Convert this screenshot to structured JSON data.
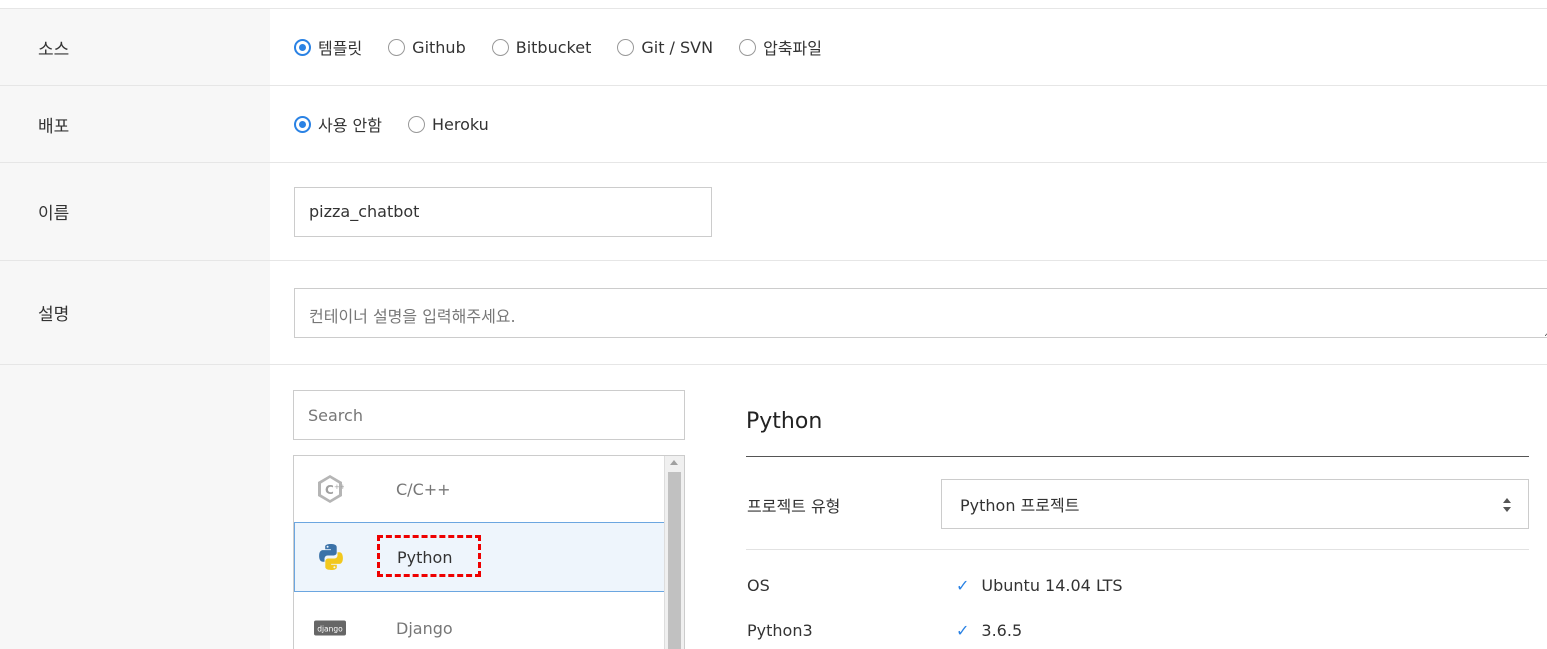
{
  "source": {
    "label": "소스",
    "options": [
      "템플릿",
      "Github",
      "Bitbucket",
      "Git / SVN",
      "압축파일"
    ],
    "selected": "템플릿"
  },
  "deploy": {
    "label": "배포",
    "options": [
      "사용 안함",
      "Heroku"
    ],
    "selected": "사용 안함"
  },
  "name": {
    "label": "이름",
    "value": "pizza_chatbot"
  },
  "description": {
    "label": "설명",
    "placeholder": "컨테이너 설명을 입력해주세요."
  },
  "stack": {
    "search_placeholder": "Search",
    "items": [
      {
        "label": "C/C++",
        "icon": "cpp-icon"
      },
      {
        "label": "Python",
        "icon": "python-icon",
        "selected": true
      },
      {
        "label": "Django",
        "icon": "django-icon",
        "icon_text": "django"
      }
    ]
  },
  "detail": {
    "title": "Python",
    "project_type_label": "프로젝트 유형",
    "project_type_value": "Python 프로젝트",
    "specs": [
      {
        "key": "OS",
        "value": "Ubuntu 14.04 LTS"
      },
      {
        "key": "Python3",
        "value": "3.6.5"
      }
    ]
  },
  "colors": {
    "accent": "#2a82e4",
    "highlight": "#e00000"
  }
}
